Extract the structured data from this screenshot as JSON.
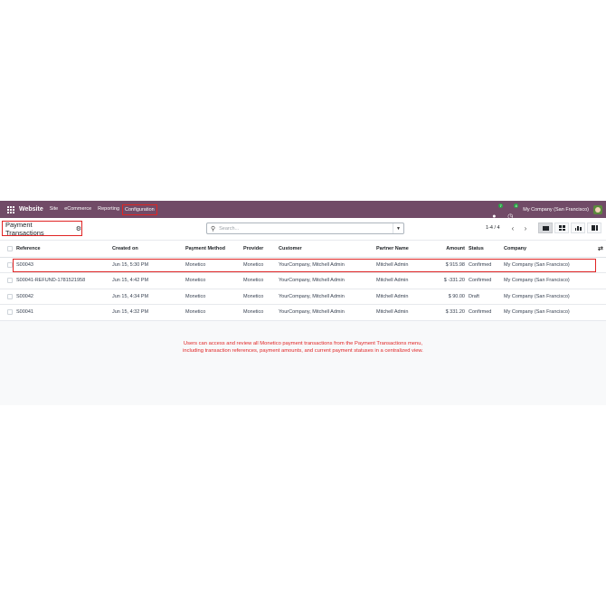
{
  "navbar": {
    "brand": "Website",
    "menu": [
      "Site",
      "eCommerce",
      "Reporting",
      "Configuration"
    ],
    "messages_badge": "7",
    "activity_badge": "4",
    "company": "My Company (San Francisco)"
  },
  "control": {
    "title": "Payment Transactions",
    "search_placeholder": "Search...",
    "pager": "1-4 / 4"
  },
  "table": {
    "columns": [
      "Reference",
      "Created on",
      "Payment Method",
      "Provider",
      "Customer",
      "Partner Name",
      "Amount",
      "Status",
      "Company"
    ],
    "rows": [
      {
        "reference": "S00043",
        "created": "Jun 15, 5:30 PM",
        "method": "Monetico",
        "provider": "Monetico",
        "customer": "YourCompany, Mitchell Admin",
        "partner": "Mitchell Admin",
        "amount": "$ 915.98",
        "status": "Confirmed",
        "company": "My Company (San Francisco)"
      },
      {
        "reference": "S00041-REFUND-1781521958",
        "created": "Jun 15, 4:42 PM",
        "method": "Monetico",
        "provider": "Monetico",
        "customer": "YourCompany, Mitchell Admin",
        "partner": "Mitchell Admin",
        "amount": "$ -331.20",
        "status": "Confirmed",
        "company": "My Company (San Francisco)"
      },
      {
        "reference": "S00042",
        "created": "Jun 15, 4:34 PM",
        "method": "Monetico",
        "provider": "Monetico",
        "customer": "YourCompany, Mitchell Admin",
        "partner": "Mitchell Admin",
        "amount": "$ 90.00",
        "status": "Draft",
        "company": "My Company (San Francisco)"
      },
      {
        "reference": "S00041",
        "created": "Jun 15, 4:32 PM",
        "method": "Monetico",
        "provider": "Monetico",
        "customer": "YourCompany, Mitchell Admin",
        "partner": "Mitchell Admin",
        "amount": "$ 331.20",
        "status": "Confirmed",
        "company": "My Company (San Francisco)"
      }
    ]
  },
  "caption": {
    "line1": "Users can access and review all Monetico payment transactions from the Payment Transactions menu,",
    "line2": "including transaction references, payment amounts, and current payment statuses in a centralized view."
  },
  "colors": {
    "navbar": "#714b67",
    "highlight": "#e02424"
  }
}
